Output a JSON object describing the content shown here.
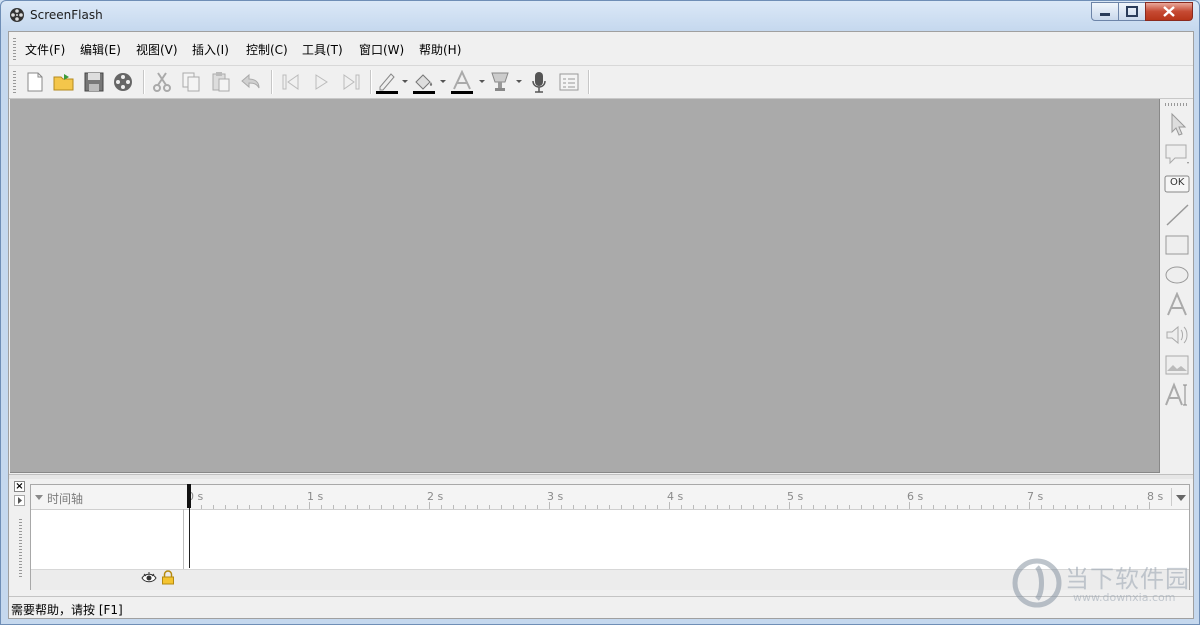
{
  "window": {
    "title": "ScreenFlash"
  },
  "menu": [
    {
      "label": "文件(F)"
    },
    {
      "label": "编辑(E)"
    },
    {
      "label": "视图(V)"
    },
    {
      "label": "插入(I)"
    },
    {
      "label": "控制(C)"
    },
    {
      "label": "工具(T)"
    },
    {
      "label": "窗口(W)"
    },
    {
      "label": "帮助(H)"
    }
  ],
  "toolbar": {
    "icons": [
      "new-file-icon",
      "open-folder-icon",
      "save-icon",
      "film-reel-icon",
      "cut-icon",
      "copy-icon",
      "paste-icon",
      "undo-icon",
      "step-back-icon",
      "play-icon",
      "step-forward-icon",
      "pen-color-icon",
      "fill-color-icon",
      "text-color-icon",
      "cup-icon",
      "microphone-icon",
      "properties-icon"
    ]
  },
  "tools": [
    "pointer-tool",
    "callout-tool",
    "button-tool",
    "line-tool",
    "rectangle-tool",
    "ellipse-tool",
    "text-tool",
    "sound-tool",
    "image-tool",
    "text-field-tool"
  ],
  "tools_labels": {
    "button_tool": "OK"
  },
  "timeline": {
    "close_label": "×",
    "label": "时间轴",
    "ruler": [
      "0 s",
      "1 s",
      "2 s",
      "3 s",
      "4 s",
      "5 s",
      "6 s",
      "7 s",
      "8 s"
    ]
  },
  "status": {
    "text": "需要帮助，请按 [F1]"
  },
  "watermark": {
    "text": "当下软件园",
    "url": "www.downxia.com"
  },
  "colors": {
    "canvas": "#aaaaaa",
    "chrome": "#f0f0f0",
    "close": "#c64a33"
  }
}
